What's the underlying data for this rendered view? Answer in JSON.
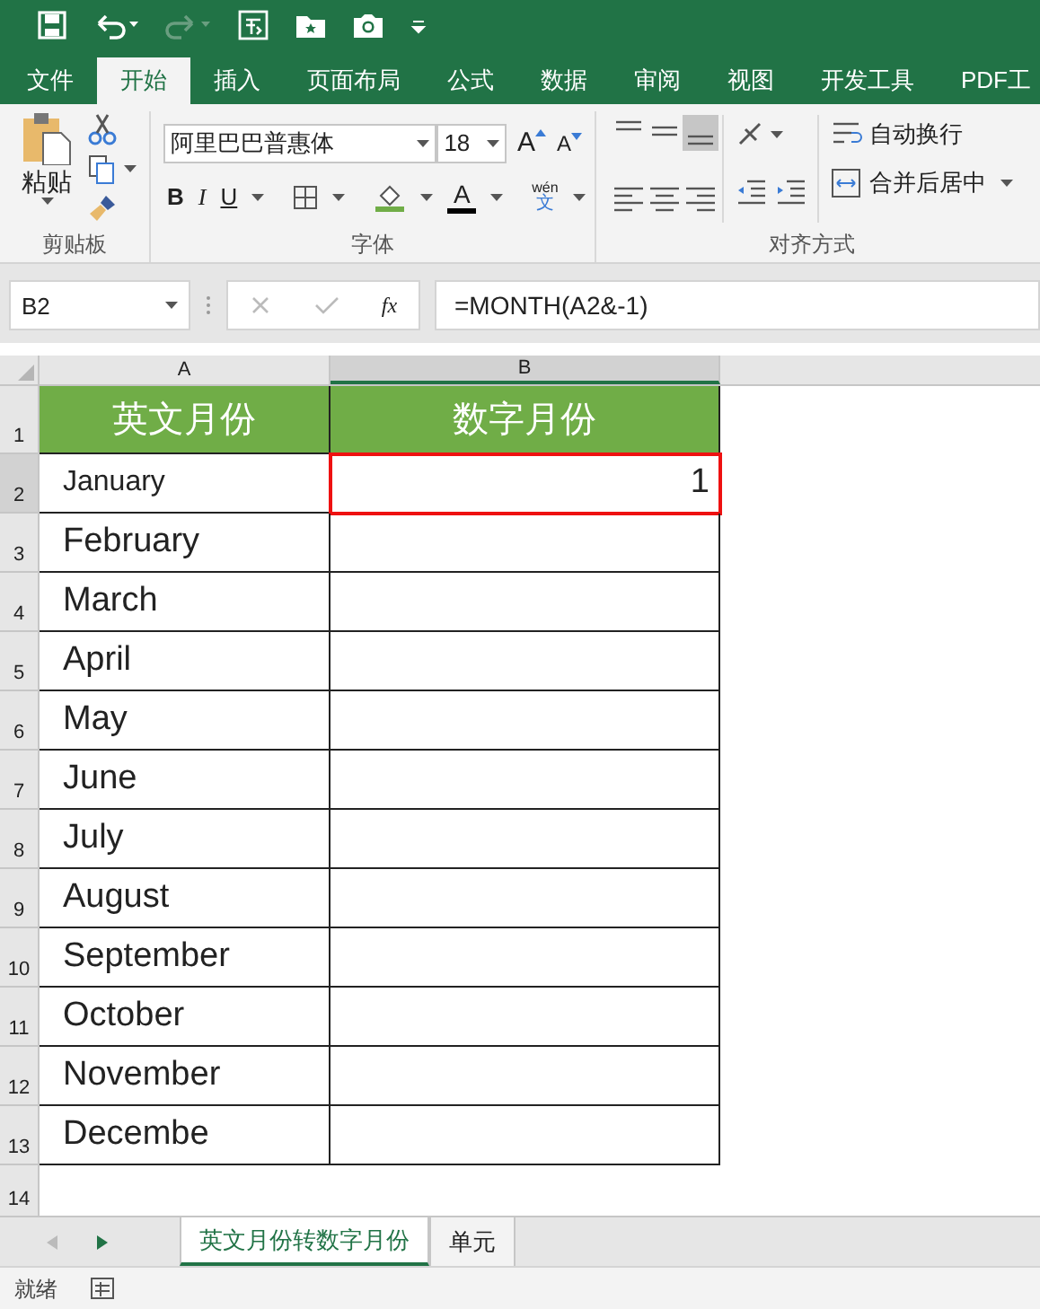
{
  "ribbon_tabs": [
    {
      "label": "文件",
      "selected": false
    },
    {
      "label": "开始",
      "selected": true
    },
    {
      "label": "插入",
      "selected": false
    },
    {
      "label": "页面布局",
      "selected": false
    },
    {
      "label": "公式",
      "selected": false
    },
    {
      "label": "数据",
      "selected": false
    },
    {
      "label": "审阅",
      "selected": false
    },
    {
      "label": "视图",
      "selected": false
    },
    {
      "label": "开发工具",
      "selected": false
    },
    {
      "label": "PDF工",
      "selected": false
    }
  ],
  "clipboard": {
    "paste": "粘贴",
    "group_label": "剪贴板"
  },
  "font": {
    "name": "阿里巴巴普惠体",
    "size": "18",
    "grow": "A",
    "shrink": "A",
    "bold": "B",
    "italic": "I",
    "underline": "U",
    "font_color": "A",
    "phonetic_top": "wén",
    "phonetic_bottom": "文",
    "group_label": "字体"
  },
  "alignment": {
    "wrap": "自动换行",
    "merge": "合并后居中",
    "group_label": "对齐方式"
  },
  "formula_bar": {
    "name_box": "B2",
    "fx": "fx",
    "formula": "=MONTH(A2&-1)"
  },
  "columns": [
    {
      "label": "A",
      "selected": false
    },
    {
      "label": "B",
      "selected": true
    }
  ],
  "header_row": {
    "number": "1",
    "cells": [
      "英文月份",
      "数字月份"
    ]
  },
  "rows": [
    {
      "number": "2",
      "cells": [
        "January",
        "1"
      ],
      "selected": true
    },
    {
      "number": "3",
      "cells": [
        "February",
        ""
      ],
      "selected": false
    },
    {
      "number": "4",
      "cells": [
        "March",
        ""
      ],
      "selected": false
    },
    {
      "number": "5",
      "cells": [
        "April",
        ""
      ],
      "selected": false
    },
    {
      "number": "6",
      "cells": [
        "May",
        ""
      ],
      "selected": false
    },
    {
      "number": "7",
      "cells": [
        "June",
        ""
      ],
      "selected": false
    },
    {
      "number": "8",
      "cells": [
        "July",
        ""
      ],
      "selected": false
    },
    {
      "number": "9",
      "cells": [
        "August",
        ""
      ],
      "selected": false
    },
    {
      "number": "10",
      "cells": [
        "September",
        ""
      ],
      "selected": false
    },
    {
      "number": "11",
      "cells": [
        "October",
        ""
      ],
      "selected": false
    },
    {
      "number": "12",
      "cells": [
        "November",
        ""
      ],
      "selected": false
    },
    {
      "number": "13",
      "cells": [
        "Decembe",
        ""
      ],
      "selected": false
    }
  ],
  "empty_row": {
    "number": "14"
  },
  "sheet_tabs": [
    {
      "label": "英文月份转数字月份",
      "selected": true
    },
    {
      "label": "单元",
      "selected": false
    }
  ],
  "status": "就绪"
}
